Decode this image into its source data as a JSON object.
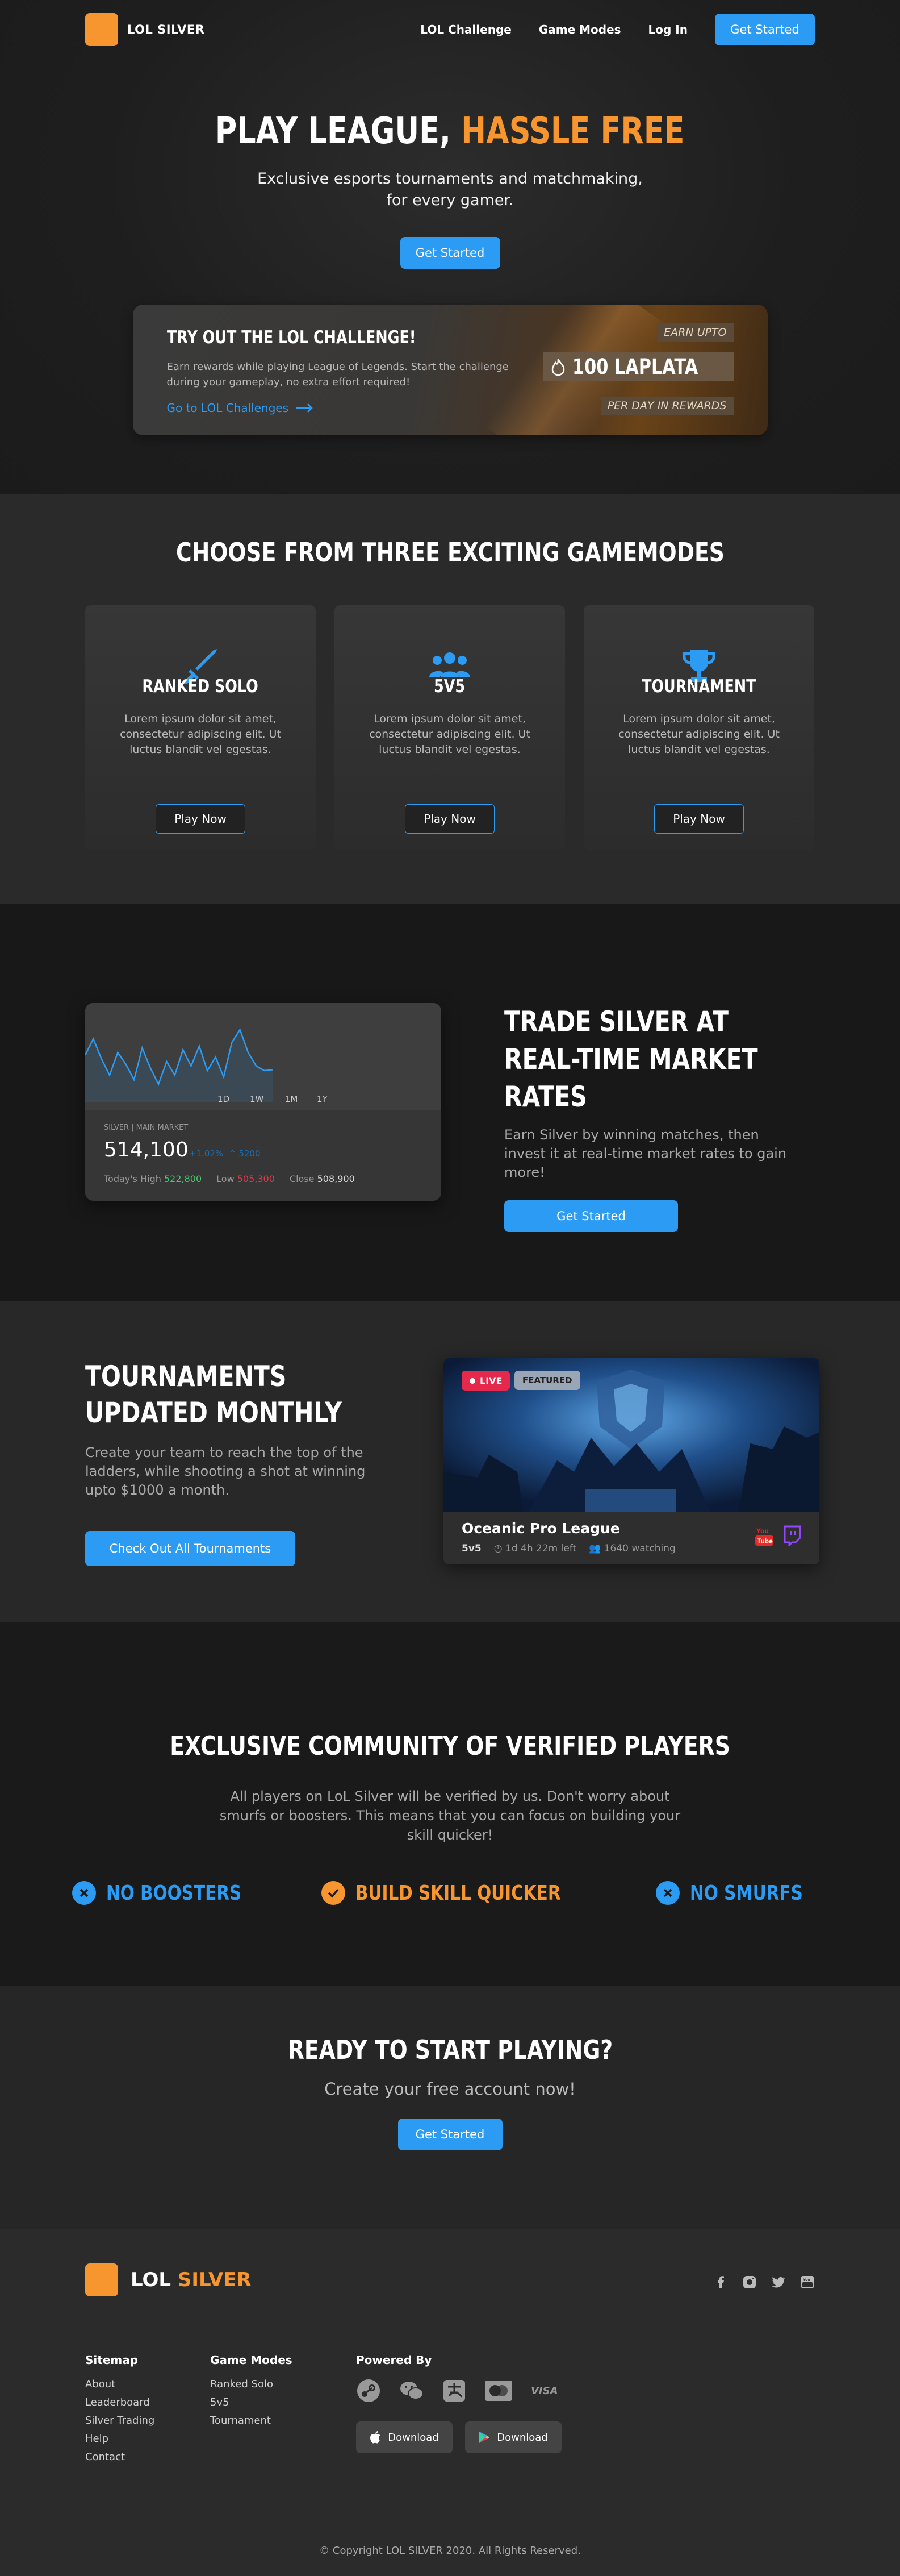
{
  "nav": {
    "brand": "LOL SILVER",
    "links": [
      "LOL Challenge",
      "Game Modes",
      "Log In"
    ],
    "cta": "Get Started"
  },
  "hero": {
    "title_a": "PLAY LEAGUE,",
    "title_b": "HASSLE FREE",
    "subtitle_1": "Exclusive esports tournaments and matchmaking,",
    "subtitle_2": "for every gamer.",
    "cta": "Get Started"
  },
  "promo": {
    "title": "TRY OUT THE LOL CHALLENGE!",
    "desc": "Earn rewards while playing League of Legends. Start the challenge during your gameplay, no extra effort required!",
    "link": "Go to LOL Challenges",
    "earn": "EARN UPTO",
    "amount": "100 LAPLATA",
    "per": "PER DAY IN REWARDS"
  },
  "modes": {
    "title": "CHOOSE FROM THREE EXCITING GAMEMODES",
    "cards": [
      {
        "title": "RANKED SOLO",
        "icon": "sword-icon",
        "desc": "Lorem ipsum dolor sit amet, consectetur adipiscing elit. Ut luctus blandit vel egestas.",
        "btn": "Play Now"
      },
      {
        "title": "5V5",
        "icon": "team-icon",
        "desc": "Lorem ipsum dolor sit amet, consectetur adipiscing elit. Ut luctus blandit vel egestas.",
        "btn": "Play Now"
      },
      {
        "title": "TOURNAMENT",
        "icon": "trophy-icon",
        "desc": "Lorem ipsum dolor sit amet, consectetur adipiscing elit. Ut luctus blandit vel egestas.",
        "btn": "Play Now"
      }
    ]
  },
  "trade": {
    "ranges": [
      "1D",
      "1W",
      "1M",
      "1Y"
    ],
    "label": "SILVER | MAIN MARKET",
    "price": "514,100",
    "change_pct": "+1.02%",
    "change_abs": "5200",
    "high_label": "Today's High",
    "high": "522,800",
    "low_label": "Low",
    "low": "505,300",
    "close_label": "Close",
    "close": "508,900",
    "title": "TRADE SILVER AT REAL-TIME MARKET RATES",
    "desc": "Earn Silver by winning matches, then invest it at real-time market rates to gain more!",
    "cta": "Get Started"
  },
  "chart_data": {
    "type": "line",
    "series": [
      {
        "values": [
          52,
          70,
          48,
          30,
          55,
          42,
          25,
          60,
          38,
          20,
          45,
          30,
          58,
          40,
          62,
          35,
          50,
          28,
          66,
          80,
          55,
          40,
          35,
          36
        ]
      }
    ]
  },
  "tourn": {
    "title": "TOURNAMENTS UPDATED MONTHLY",
    "desc": "Create your team to reach the top of the ladders, while shooting a shot at winning upto $1000 a month.",
    "cta": "Check Out All Tournaments",
    "live": "LIVE",
    "featured": "FEATURED",
    "name": "Oceanic Pro League",
    "mode": "5v5",
    "time": "1d 4h 22m left",
    "watching": "1640 watching"
  },
  "comm": {
    "title": "EXCLUSIVE COMMUNITY OF VERIFIED PLAYERS",
    "desc": "All players on LoL Silver will be verified by us. Don't worry about smurfs or boosters. This means that you can focus on building your skill quicker!",
    "items": [
      "NO BOOSTERS",
      "BUILD SKILL QUICKER",
      "NO SMURFS"
    ]
  },
  "ready": {
    "title": "READY TO START PLAYING?",
    "subtitle": "Create your free account now!",
    "cta": "Get Started"
  },
  "footer": {
    "brand_a": "LOL",
    "brand_b": "SILVER",
    "sitemap_title": "Sitemap",
    "sitemap": [
      "About",
      "Leaderboard",
      "Silver Trading",
      "Help",
      "Contact"
    ],
    "modes_title": "Game Modes",
    "modes": [
      "Ranked Solo",
      "5v5",
      "Tournament"
    ],
    "powered_title": "Powered By",
    "visa": "VISA",
    "download": "Download",
    "copyright": "© Copyright LOL SILVER 2020. All Rights Reserved."
  },
  "colors": {
    "accent": "#2b9bf4",
    "orange": "#f7952f"
  }
}
